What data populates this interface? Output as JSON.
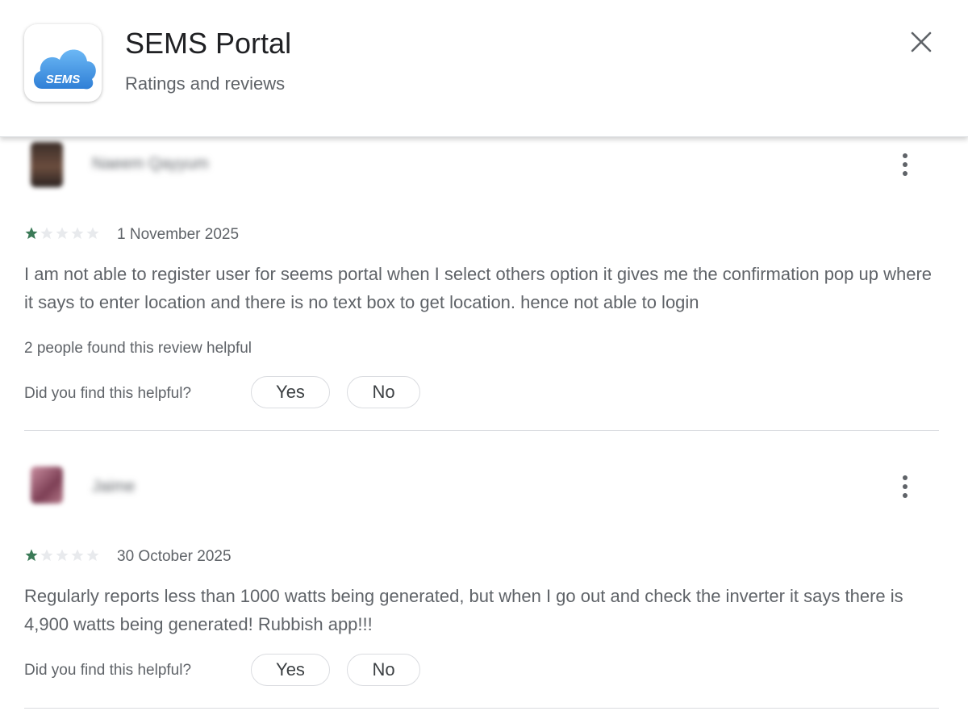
{
  "app": {
    "title": "SEMS Portal",
    "subtitle": "Ratings and reviews",
    "icon_text": "SEMS",
    "icon_color": "#3d8fe0"
  },
  "reviews": [
    {
      "author": "Naeem Qayyum",
      "rating": 1,
      "max_rating": 5,
      "date": "1 November 2025",
      "text": "I am not able to register user for seems portal when I select others option it gives me the confirmation pop up where it says to enter location and there is no text box to get location. hence not able to login",
      "helpful_count_text": "2 people found this review helpful",
      "helpful_question": "Did you find this helpful?",
      "yes_label": "Yes",
      "no_label": "No"
    },
    {
      "author": "Jaime",
      "rating": 1,
      "max_rating": 5,
      "date": "30 October 2025",
      "text": "Regularly reports less than 1000 watts being generated, but when I go out and check the inverter it says there is 4,900 watts being generated! Rubbish app!!!",
      "helpful_question": "Did you find this helpful?",
      "yes_label": "Yes",
      "no_label": "No"
    }
  ],
  "colors": {
    "star_filled": "#3b7a57",
    "star_empty": "#e8eaed",
    "text_secondary": "#5f6368"
  }
}
